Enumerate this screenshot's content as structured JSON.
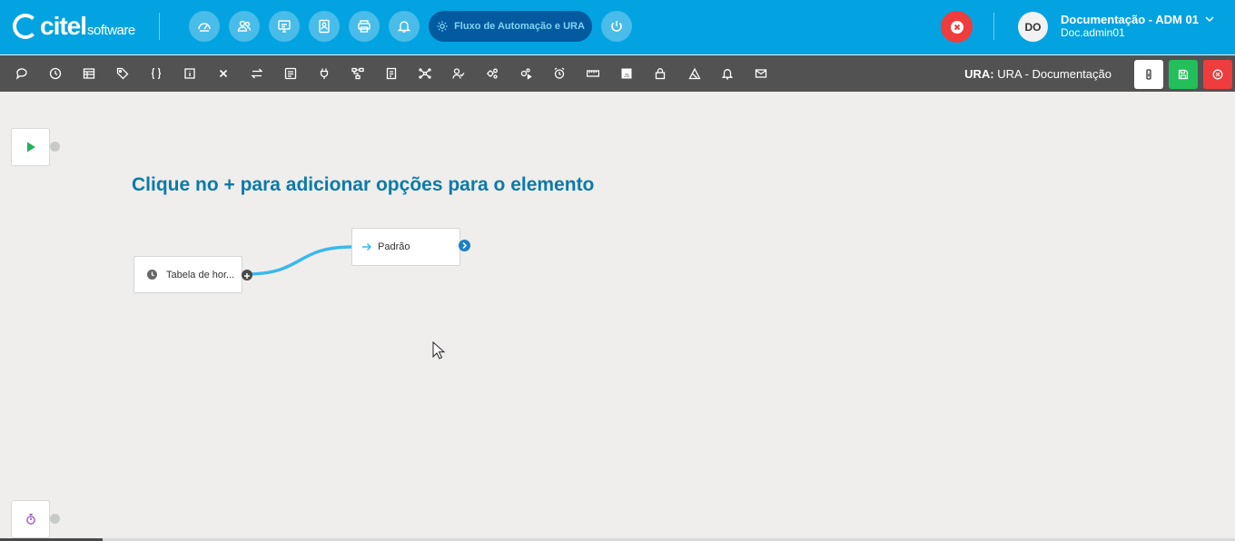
{
  "header": {
    "logo_text": "citel",
    "logo_sub": "software",
    "nav_icons": [
      "dashboard-icon",
      "users-icon",
      "monitor-icon",
      "contact-card-icon",
      "printer-icon",
      "bell-icon"
    ],
    "active_nav_label": "Fluxo de Automação e URA",
    "power_icon": "power-icon",
    "user_avatar": "DO",
    "user_name": "Documentação - ADM 01",
    "user_login": "Doc.admin01"
  },
  "toolbar": {
    "tools": [
      "speech-bubble-icon",
      "clock-icon",
      "table-icon",
      "tag-icon",
      "braces-icon",
      "info-icon",
      "close-x-icon",
      "transfer-icon",
      "form-icon",
      "plug-icon",
      "tree-icon",
      "document-icon",
      "network-icon",
      "user-check-icon",
      "gears-icon",
      "gears-play-icon",
      "alarm-icon",
      "ruler-icon",
      "js-icon",
      "lock-icon",
      "eraser-icon",
      "bell-icon",
      "mail-icon"
    ],
    "ura_prefix": "URA:",
    "ura_name": "URA - Documentação"
  },
  "canvas": {
    "hint": "Clique no + para adicionar opções para o elemento",
    "node_timetable": "Tabela de hor...",
    "node_default": "Padrão",
    "colors": {
      "connector": "#3bb8ee",
      "accent": "#0c7aa8"
    }
  }
}
